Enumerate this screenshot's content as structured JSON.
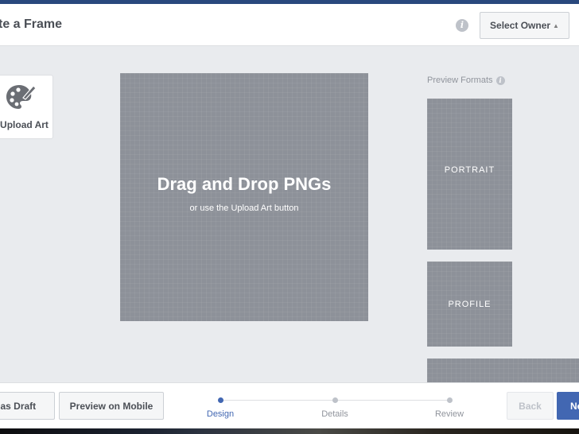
{
  "header": {
    "title": "te a Frame",
    "info_icon": "info-icon",
    "select_owner_label": "Select Owner",
    "select_owner_caret": "⇕"
  },
  "sidebar": {
    "upload_art": {
      "icon": "palette-icon",
      "label": "Upload Art"
    }
  },
  "canvas": {
    "title": "Drag and Drop PNGs",
    "subtitle": "or use the Upload Art button"
  },
  "preview": {
    "label": "Preview Formats",
    "info_icon": "info-icon",
    "formats": [
      {
        "label": "PORTRAIT"
      },
      {
        "label": "PROFILE"
      },
      {
        "label": ""
      }
    ]
  },
  "footer": {
    "save_draft_label": "ve as Draft",
    "preview_mobile_label": "Preview on Mobile",
    "back_label": "Back",
    "next_label": "Ne",
    "steps": [
      {
        "label": "Design",
        "active": true
      },
      {
        "label": "Details",
        "active": false
      },
      {
        "label": "Review",
        "active": false
      }
    ],
    "accent_color": "#4267b2"
  }
}
